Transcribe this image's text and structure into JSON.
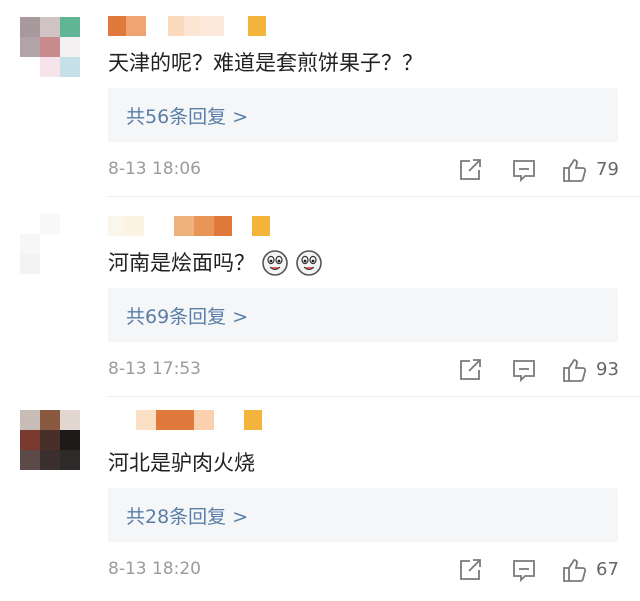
{
  "comments": [
    {
      "text": "天津的呢？难道是套煎饼果子？？",
      "replies_label": "共56条回复 >",
      "timestamp": "8-13 18:06",
      "likes": "79"
    },
    {
      "text": "河南是烩面吗？",
      "replies_label": "共69条回复 >",
      "timestamp": "8-13 17:53",
      "likes": "93"
    },
    {
      "text": "河北是驴肉火烧",
      "replies_label": "共28条回复 >",
      "timestamp": "8-13 18:20",
      "likes": "67"
    }
  ],
  "colors": {
    "reply_link": "#5a7ea8",
    "reply_bg": "#f5f6f8",
    "meta_text": "#9b9b9b",
    "body_text": "#222222"
  },
  "icons": [
    "share-icon",
    "reply-icon",
    "thumb-up-icon",
    "emoji-icon"
  ]
}
